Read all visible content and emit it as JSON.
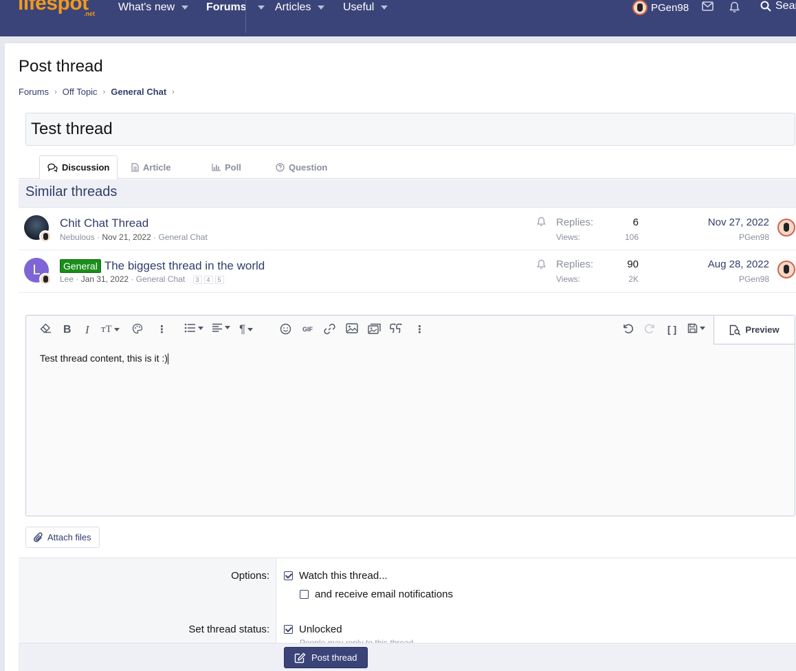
{
  "brand": {
    "logo": "lifespot",
    "logo_suffix": ".net"
  },
  "nav": {
    "items": [
      {
        "label": "What's new"
      },
      {
        "label": "Forums"
      },
      {
        "label": "Articles"
      },
      {
        "label": "Useful"
      }
    ],
    "username": "PGen98",
    "search_label": "Search"
  },
  "page": {
    "title": "Post thread"
  },
  "breadcrumb": [
    "Forums",
    "Off Topic",
    "General Chat"
  ],
  "thread_title": "Test thread",
  "tabs": [
    "Discussion",
    "Article",
    "Poll",
    "Question"
  ],
  "similar": {
    "heading": "Similar threads",
    "threads": [
      {
        "title": "Chit Chat Thread",
        "prefix": "",
        "author": "Nebulous",
        "date": "Nov 21, 2022",
        "forum": "General Chat",
        "replies_label": "Replies:",
        "replies": "6",
        "views_label": "Views:",
        "views": "106",
        "last_date": "Nov 27, 2022",
        "last_user": "PGen98",
        "avatar_letter": "",
        "pages": []
      },
      {
        "title": "The biggest thread in the world",
        "prefix": "General",
        "author": "Lee",
        "date": "Jan 31, 2022",
        "forum": "General Chat",
        "replies_label": "Replies:",
        "replies": "90",
        "views_label": "Views:",
        "views": "2K",
        "last_date": "Aug 28, 2022",
        "last_user": "PGen98",
        "avatar_letter": "L",
        "pages": [
          "3",
          "4",
          "5"
        ]
      }
    ]
  },
  "editor": {
    "content": "Test thread content, this is it :)",
    "preview_label": "Preview"
  },
  "attach_label": "Attach files",
  "options": {
    "options_label": "Options:",
    "watch_label": "Watch this thread...",
    "email_label": "and receive email notifications",
    "status_label": "Set thread status:",
    "unlocked_label": "Unlocked",
    "unlocked_hint": "People may reply to this thread"
  },
  "submit_label": "Post thread",
  "colors": {
    "accent": "#3b4478",
    "brand": "#f29a1b",
    "prefix_green": "#1a8d1a"
  }
}
